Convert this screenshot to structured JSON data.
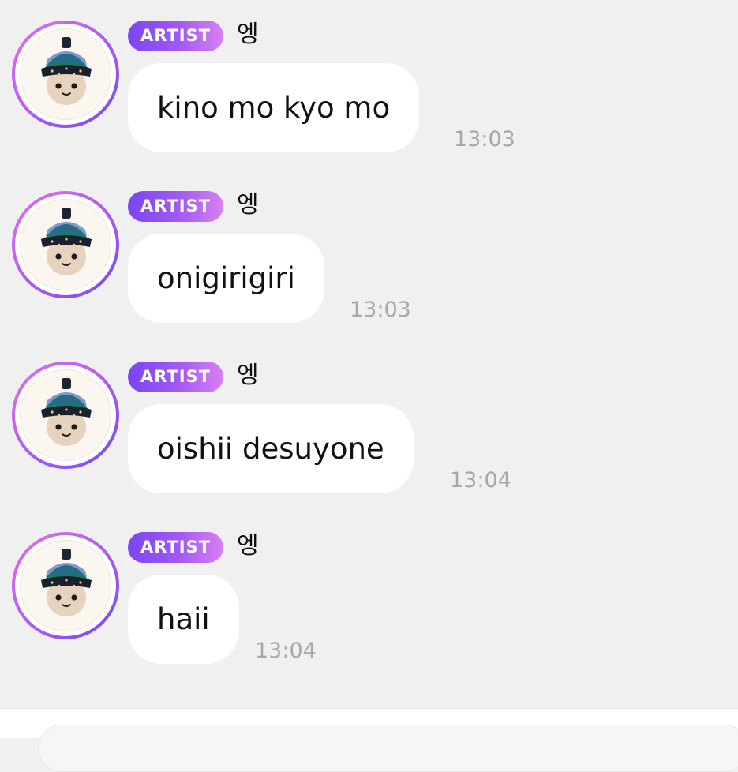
{
  "messages": [
    {
      "badge": "ARTIST",
      "sender": "엥",
      "text": "kino mo kyo mo",
      "time": "13:03"
    },
    {
      "badge": "ARTIST",
      "sender": "엥",
      "text": "onigirigiri",
      "time": "13:03"
    },
    {
      "badge": "ARTIST",
      "sender": "엥",
      "text": "oishii desuyone",
      "time": "13:04"
    },
    {
      "badge": "ARTIST",
      "sender": "엥",
      "text": "haii",
      "time": "13:04"
    }
  ],
  "colors": {
    "background": "#f0f0f0",
    "bubble": "#ffffff",
    "badge_start": "#7a45f2",
    "badge_end": "#d780f2",
    "timestamp": "#a8a8a8"
  },
  "icons": {
    "avatar": "onigiri-character-avatar-icon"
  }
}
